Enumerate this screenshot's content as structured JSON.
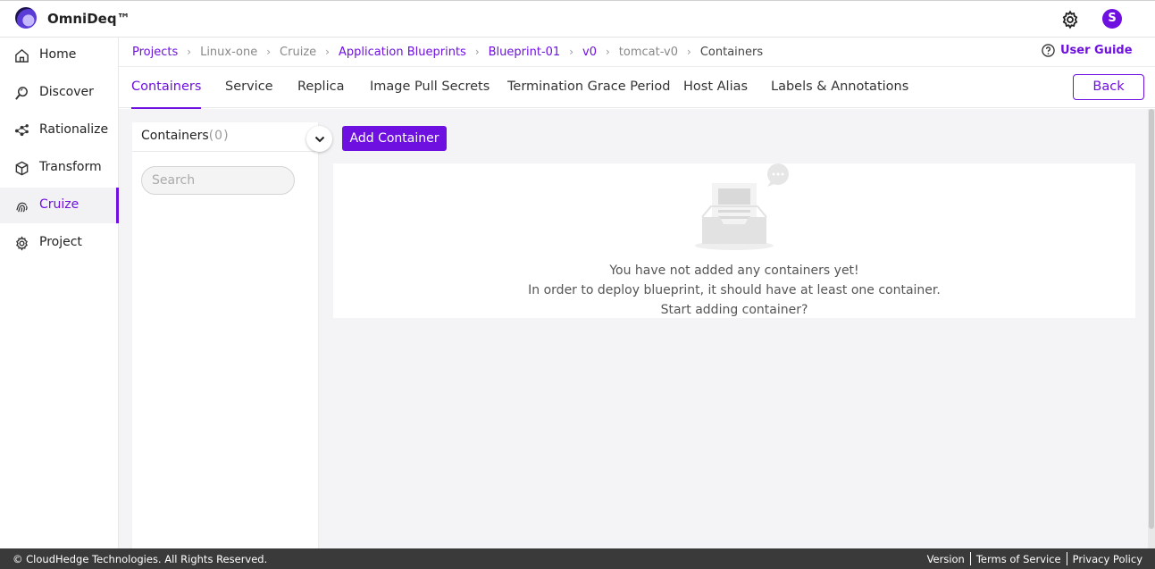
{
  "header": {
    "app_title": "OmniDeq™",
    "avatar_initial": "S"
  },
  "sidebar": {
    "items": [
      {
        "label": "Home",
        "icon": "home-icon"
      },
      {
        "label": "Discover",
        "icon": "discover-icon"
      },
      {
        "label": "Rationalize",
        "icon": "rationalize-icon"
      },
      {
        "label": "Transform",
        "icon": "cube-icon"
      },
      {
        "label": "Cruize",
        "icon": "fingerprint-icon",
        "active": true
      },
      {
        "label": "Project",
        "icon": "gear-icon"
      }
    ]
  },
  "breadcrumb": {
    "items": [
      "Projects",
      "Linux-one",
      "Cruize",
      "Application Blueprints",
      "Blueprint-01",
      "v0",
      "tomcat-v0",
      "Containers"
    ]
  },
  "user_guide": "User Guide",
  "tabs": [
    "Containers",
    "Service",
    "Replica",
    "Image Pull Secrets",
    "Termination Grace Period",
    "Host Alias",
    "Labels & Annotations"
  ],
  "back_button": "Back",
  "containers_panel": {
    "title": "Containers",
    "count": "(0)",
    "search_placeholder": "Search"
  },
  "add_container_button": "Add Container",
  "empty_state": {
    "line1": "You have not added any containers yet!",
    "line2": "In order to deploy blueprint, it should have at least one container.",
    "line3": "Start adding container?"
  },
  "footer": {
    "copyright": "© CloudHedge Technologies. All Rights Reserved.",
    "links": [
      "Version",
      "Terms of Service",
      "Privacy Policy"
    ]
  },
  "colors": {
    "accent": "#6e10e0",
    "footer_bg": "#3a3a3a",
    "content_bg": "#f4f4f6"
  }
}
